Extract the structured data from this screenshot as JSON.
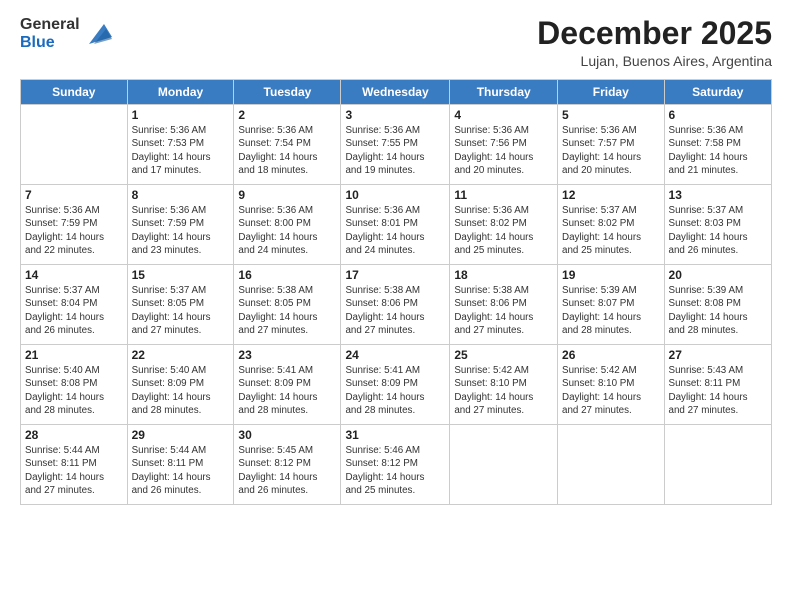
{
  "logo": {
    "line1": "General",
    "line2": "Blue"
  },
  "title": "December 2025",
  "location": "Lujan, Buenos Aires, Argentina",
  "days_of_week": [
    "Sunday",
    "Monday",
    "Tuesday",
    "Wednesday",
    "Thursday",
    "Friday",
    "Saturday"
  ],
  "weeks": [
    [
      {
        "day": "",
        "info": ""
      },
      {
        "day": "1",
        "info": "Sunrise: 5:36 AM\nSunset: 7:53 PM\nDaylight: 14 hours\nand 17 minutes."
      },
      {
        "day": "2",
        "info": "Sunrise: 5:36 AM\nSunset: 7:54 PM\nDaylight: 14 hours\nand 18 minutes."
      },
      {
        "day": "3",
        "info": "Sunrise: 5:36 AM\nSunset: 7:55 PM\nDaylight: 14 hours\nand 19 minutes."
      },
      {
        "day": "4",
        "info": "Sunrise: 5:36 AM\nSunset: 7:56 PM\nDaylight: 14 hours\nand 20 minutes."
      },
      {
        "day": "5",
        "info": "Sunrise: 5:36 AM\nSunset: 7:57 PM\nDaylight: 14 hours\nand 20 minutes."
      },
      {
        "day": "6",
        "info": "Sunrise: 5:36 AM\nSunset: 7:58 PM\nDaylight: 14 hours\nand 21 minutes."
      }
    ],
    [
      {
        "day": "7",
        "info": "Sunrise: 5:36 AM\nSunset: 7:59 PM\nDaylight: 14 hours\nand 22 minutes."
      },
      {
        "day": "8",
        "info": "Sunrise: 5:36 AM\nSunset: 7:59 PM\nDaylight: 14 hours\nand 23 minutes."
      },
      {
        "day": "9",
        "info": "Sunrise: 5:36 AM\nSunset: 8:00 PM\nDaylight: 14 hours\nand 24 minutes."
      },
      {
        "day": "10",
        "info": "Sunrise: 5:36 AM\nSunset: 8:01 PM\nDaylight: 14 hours\nand 24 minutes."
      },
      {
        "day": "11",
        "info": "Sunrise: 5:36 AM\nSunset: 8:02 PM\nDaylight: 14 hours\nand 25 minutes."
      },
      {
        "day": "12",
        "info": "Sunrise: 5:37 AM\nSunset: 8:02 PM\nDaylight: 14 hours\nand 25 minutes."
      },
      {
        "day": "13",
        "info": "Sunrise: 5:37 AM\nSunset: 8:03 PM\nDaylight: 14 hours\nand 26 minutes."
      }
    ],
    [
      {
        "day": "14",
        "info": "Sunrise: 5:37 AM\nSunset: 8:04 PM\nDaylight: 14 hours\nand 26 minutes."
      },
      {
        "day": "15",
        "info": "Sunrise: 5:37 AM\nSunset: 8:05 PM\nDaylight: 14 hours\nand 27 minutes."
      },
      {
        "day": "16",
        "info": "Sunrise: 5:38 AM\nSunset: 8:05 PM\nDaylight: 14 hours\nand 27 minutes."
      },
      {
        "day": "17",
        "info": "Sunrise: 5:38 AM\nSunset: 8:06 PM\nDaylight: 14 hours\nand 27 minutes."
      },
      {
        "day": "18",
        "info": "Sunrise: 5:38 AM\nSunset: 8:06 PM\nDaylight: 14 hours\nand 27 minutes."
      },
      {
        "day": "19",
        "info": "Sunrise: 5:39 AM\nSunset: 8:07 PM\nDaylight: 14 hours\nand 28 minutes."
      },
      {
        "day": "20",
        "info": "Sunrise: 5:39 AM\nSunset: 8:08 PM\nDaylight: 14 hours\nand 28 minutes."
      }
    ],
    [
      {
        "day": "21",
        "info": "Sunrise: 5:40 AM\nSunset: 8:08 PM\nDaylight: 14 hours\nand 28 minutes."
      },
      {
        "day": "22",
        "info": "Sunrise: 5:40 AM\nSunset: 8:09 PM\nDaylight: 14 hours\nand 28 minutes."
      },
      {
        "day": "23",
        "info": "Sunrise: 5:41 AM\nSunset: 8:09 PM\nDaylight: 14 hours\nand 28 minutes."
      },
      {
        "day": "24",
        "info": "Sunrise: 5:41 AM\nSunset: 8:09 PM\nDaylight: 14 hours\nand 28 minutes."
      },
      {
        "day": "25",
        "info": "Sunrise: 5:42 AM\nSunset: 8:10 PM\nDaylight: 14 hours\nand 27 minutes."
      },
      {
        "day": "26",
        "info": "Sunrise: 5:42 AM\nSunset: 8:10 PM\nDaylight: 14 hours\nand 27 minutes."
      },
      {
        "day": "27",
        "info": "Sunrise: 5:43 AM\nSunset: 8:11 PM\nDaylight: 14 hours\nand 27 minutes."
      }
    ],
    [
      {
        "day": "28",
        "info": "Sunrise: 5:44 AM\nSunset: 8:11 PM\nDaylight: 14 hours\nand 27 minutes."
      },
      {
        "day": "29",
        "info": "Sunrise: 5:44 AM\nSunset: 8:11 PM\nDaylight: 14 hours\nand 26 minutes."
      },
      {
        "day": "30",
        "info": "Sunrise: 5:45 AM\nSunset: 8:12 PM\nDaylight: 14 hours\nand 26 minutes."
      },
      {
        "day": "31",
        "info": "Sunrise: 5:46 AM\nSunset: 8:12 PM\nDaylight: 14 hours\nand 25 minutes."
      },
      {
        "day": "",
        "info": ""
      },
      {
        "day": "",
        "info": ""
      },
      {
        "day": "",
        "info": ""
      }
    ]
  ]
}
